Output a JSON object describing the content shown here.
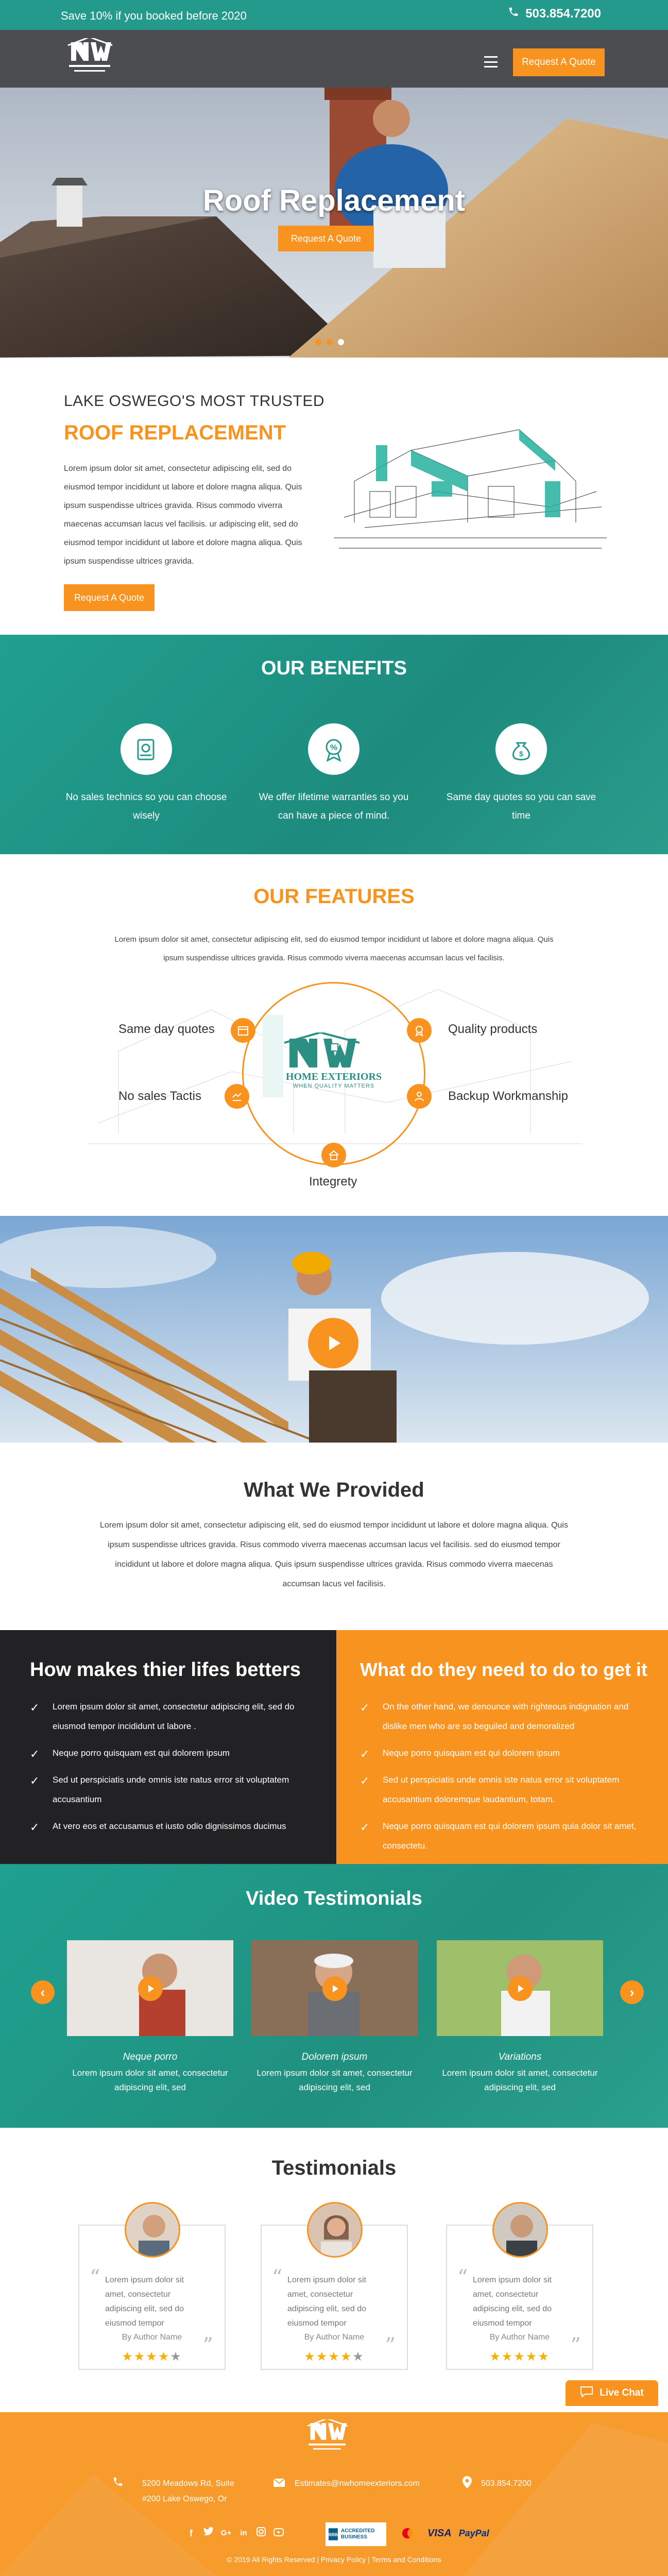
{
  "topbar": {
    "promo": "Save 10% if you booked before 2020",
    "phone": "503.854.7200"
  },
  "header": {
    "cta": "Request A Quote",
    "logo_text": "NW HOME EXTERIORS"
  },
  "hero": {
    "title": "Roof Replacement",
    "cta": "Request A Quote",
    "slides": 3,
    "active_slide": 3
  },
  "intro": {
    "eyebrow": "LAKE OSWEGO'S MOST TRUSTED",
    "title": "ROOF REPLACEMENT",
    "paragraph": "Lorem ipsum dolor sit amet, consectetur adipiscing elit, sed do eiusmod tempor incididunt ut labore et dolore magna aliqua. Quis ipsum suspendisse ultrices gravida. Risus commodo viverra maecenas accumsan lacus vel facilisis. ur adipiscing elit, sed do eiusmod tempor incididunt ut labore et dolore magna aliqua. Quis ipsum suspendisse ultrices gravida.",
    "cta": "Request A Quote"
  },
  "benefits": {
    "title": "OUR BENEFITS",
    "items": [
      {
        "icon": "no-sales-icon",
        "text": "No sales technics so you can choose wisely"
      },
      {
        "icon": "warranty-icon",
        "text": "We offer lifetime warranties so you can have a piece of mind."
      },
      {
        "icon": "money-bag-icon",
        "text": "Same day quotes so you can save time"
      }
    ]
  },
  "features": {
    "title": "OUR FEATURES",
    "paragraph": "Lorem ipsum dolor sit amet, consectetur adipiscing elit, sed do eiusmod tempor incididunt ut labore et dolore magna aliqua. Quis ipsum suspendisse ultrices gravida. Risus commodo viverra maecenas accumsan lacus vel facilisis.",
    "logo": {
      "brand": "NW",
      "line1": "HOME EXTERIORS",
      "line2": "WHEN QUALITY MATTERS"
    },
    "items": {
      "top_left": "Same day quotes",
      "top_right": "Quality products",
      "mid_left": "No sales Tactis",
      "mid_right": "Backup Workmanship",
      "bottom": "Integrety"
    }
  },
  "provided": {
    "title": "What We Provided",
    "paragraph": "Lorem ipsum dolor sit amet, consectetur adipiscing elit, sed do eiusmod tempor incididunt ut labore et dolore magna aliqua. Quis ipsum suspendisse ultrices gravida. Risus commodo viverra maecenas accumsan lacus vel facilisis.  sed do eiusmod tempor incididunt ut labore et dolore magna aliqua. Quis ipsum suspendisse ultrices gravida. Risus commodo viverra maecenas accumsan lacus vel facilisis."
  },
  "lifes": {
    "title": "How makes thier lifes betters",
    "items": [
      "Lorem ipsum dolor sit amet, consectetur adipiscing elit, sed do eiusmod tempor incididunt ut labore .",
      "Neque porro quisquam est qui dolorem ipsum",
      "Sed ut perspiciatis unde omnis iste natus error sit voluptatem accusantium",
      "At vero eos et accusamus et iusto odio dignissimos ducimus"
    ]
  },
  "needs": {
    "title": "What do they need to do to get it",
    "items": [
      "On the other hand, we denounce with righteous indignation and dislike men who are so beguiled and demoralized",
      "Neque porro quisquam est qui dolorem ipsum",
      "Sed ut perspiciatis unde omnis iste natus error sit voluptatem accusantium doloremque laudantium, totam.",
      "Neque porro quisquam est qui dolorem ipsum quia dolor sit amet, consectetu."
    ]
  },
  "video_testimonials": {
    "title": "Video Testimonials",
    "items": [
      {
        "name": "Neque porro",
        "text": "Lorem ipsum dolor sit amet, consectetur adipiscing elit, sed"
      },
      {
        "name": "Dolorem ipsum",
        "text": "Lorem ipsum dolor sit amet, consectetur adipiscing elit, sed"
      },
      {
        "name": "Variations",
        "text": "Lorem ipsum dolor sit amet, consectetur adipiscing elit, sed"
      }
    ]
  },
  "testimonials": {
    "title": "Testimonials",
    "items": [
      {
        "text": "Lorem ipsum dolor sit amet, consectetur adipiscing elit, sed do eiusmod tempor",
        "author": "By Author Name",
        "rating": 4
      },
      {
        "text": "Lorem ipsum dolor sit amet, consectetur adipiscing elit, sed do eiusmod tempor",
        "author": "By Author Name",
        "rating": 4
      },
      {
        "text": "Lorem ipsum dolor sit amet, consectetur adipiscing elit, sed do eiusmod tempor",
        "author": "By Author Name",
        "rating": 5
      }
    ]
  },
  "live_chat": "Live Chat",
  "footer": {
    "address_line1": "5200 Meadows Rd, Suite",
    "address_line2": "#200 Lake Oswego, Or",
    "email": "Estimates@nwhomeexteriors.com",
    "phone": "503.854.7200",
    "socials": [
      "facebook-icon",
      "twitter-icon",
      "google-plus-icon",
      "linkedin-icon",
      "instagram-icon",
      "youtube-icon"
    ],
    "bbb": "ACCREDITED BUSINESS",
    "payments": [
      "Mastercard",
      "VISA",
      "PayPal"
    ],
    "copyright": "© 2019 All Rights Reserved | Privacy Policy | Terms and Conditions"
  },
  "colors": {
    "teal": "#239a8b",
    "orange": "#f7931e",
    "dark": "#222224",
    "header_gray": "#4b4d51"
  }
}
